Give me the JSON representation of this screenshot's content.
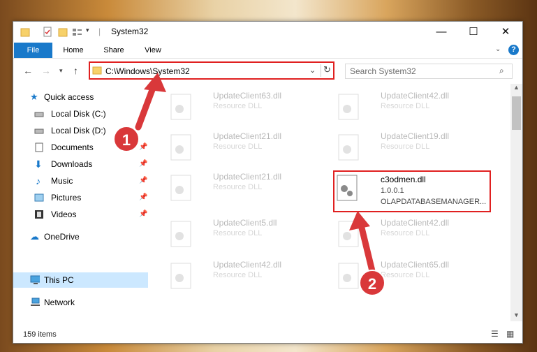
{
  "window": {
    "title": "System32",
    "controls": {
      "minimize": "—",
      "maximize": "☐",
      "close": "✕"
    }
  },
  "ribbon": {
    "tabs": [
      "File",
      "Home",
      "Share",
      "View"
    ],
    "help": "?"
  },
  "nav": {
    "address": "C:\\Windows\\System32",
    "search_placeholder": "Search System32"
  },
  "sidebar": {
    "items": [
      {
        "label": "Quick access"
      },
      {
        "label": "Local Disk (C:)"
      },
      {
        "label": "Local Disk (D:)"
      },
      {
        "label": "Documents"
      },
      {
        "label": "Downloads"
      },
      {
        "label": "Music"
      },
      {
        "label": "Pictures"
      },
      {
        "label": "Videos"
      },
      {
        "label": "OneDrive"
      },
      {
        "label": "This PC"
      },
      {
        "label": "Network"
      }
    ]
  },
  "files": [
    {
      "name": "UpdateClient63.dll",
      "sub": "Resource DLL"
    },
    {
      "name": "UpdateClient42.dll",
      "sub": "Resource DLL"
    },
    {
      "name": "UpdateClient21.dll",
      "sub": "Resource DLL"
    },
    {
      "name": "UpdateClient19.dll",
      "sub": "Resource DLL"
    },
    {
      "name": "UpdateClient21.dll",
      "sub": "Resource DLL"
    },
    {
      "name": "c3odmen.dll",
      "sub": "1.0.0.1",
      "sub2": "OLAPDATABASEMANAGER..."
    },
    {
      "name": "UpdateClient5.dll",
      "sub": "Resource DLL"
    },
    {
      "name": "UpdateClient42.dll",
      "sub": "Resource DLL"
    },
    {
      "name": "UpdateClient42.dll",
      "sub": "Resource DLL"
    },
    {
      "name": "UpdateClient65.dll",
      "sub": "Resource DLL"
    }
  ],
  "status": {
    "count": "159 items"
  },
  "callouts": {
    "one": "1",
    "two": "2"
  },
  "colors": {
    "accent": "#1979ca",
    "highlight": "#e02020",
    "callout": "#d9383a",
    "selected": "#cce8ff"
  }
}
